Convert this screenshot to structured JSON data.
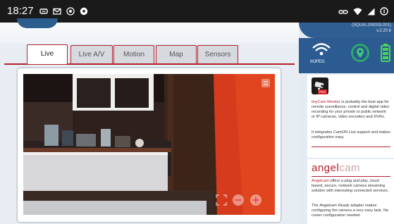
{
  "status_bar": {
    "time": "18:27",
    "left_icons": [
      "cast-icon",
      "gmail-icon",
      "cam-app-icon",
      "soccer-ball-icon"
    ],
    "right_icons": [
      "link-icon",
      "wifi-icon",
      "signal-icon",
      "battery-saver-icon"
    ]
  },
  "tabs": [
    {
      "label": "Live",
      "active": true
    },
    {
      "label": "Live A/V",
      "active": false
    },
    {
      "label": "Motion",
      "active": false
    },
    {
      "label": "Map",
      "active": false
    },
    {
      "label": "Sensors",
      "active": false
    }
  ],
  "sidebar": {
    "version_line1": "(SQUIA.200003.001)",
    "version_line2": "v.2.20.6",
    "wifi_label": "MJPEG",
    "tinycam": {
      "badge": "PRO",
      "text_brand": "tinyCam Monitor",
      "text_rest": " is probably the best app for remote surveillance, control and digital video recording for your private or public network or IP cameras, video encoders and DVRs.",
      "text2_pre": "It integrates ",
      "text2_em": "CamON Live",
      "text2_post": " support and makes configuration easy."
    },
    "angelcam": {
      "logo_main": "angel",
      "logo_light": "cam",
      "text_brand": "Angelcam",
      "text_rest": " offers a plug and play, cloud based, secure, network camera streaming solution with interesting connected services.",
      "text2_pre": "The ",
      "text2_em": "Angelcam Ready",
      "text2_post": " adapter makes configuring the camera a very easy task. No router configuration needed."
    }
  },
  "colors": {
    "accent_red": "#b3202c",
    "brand_blue": "#2b5b91",
    "status_bar": "#1a1a1a"
  }
}
